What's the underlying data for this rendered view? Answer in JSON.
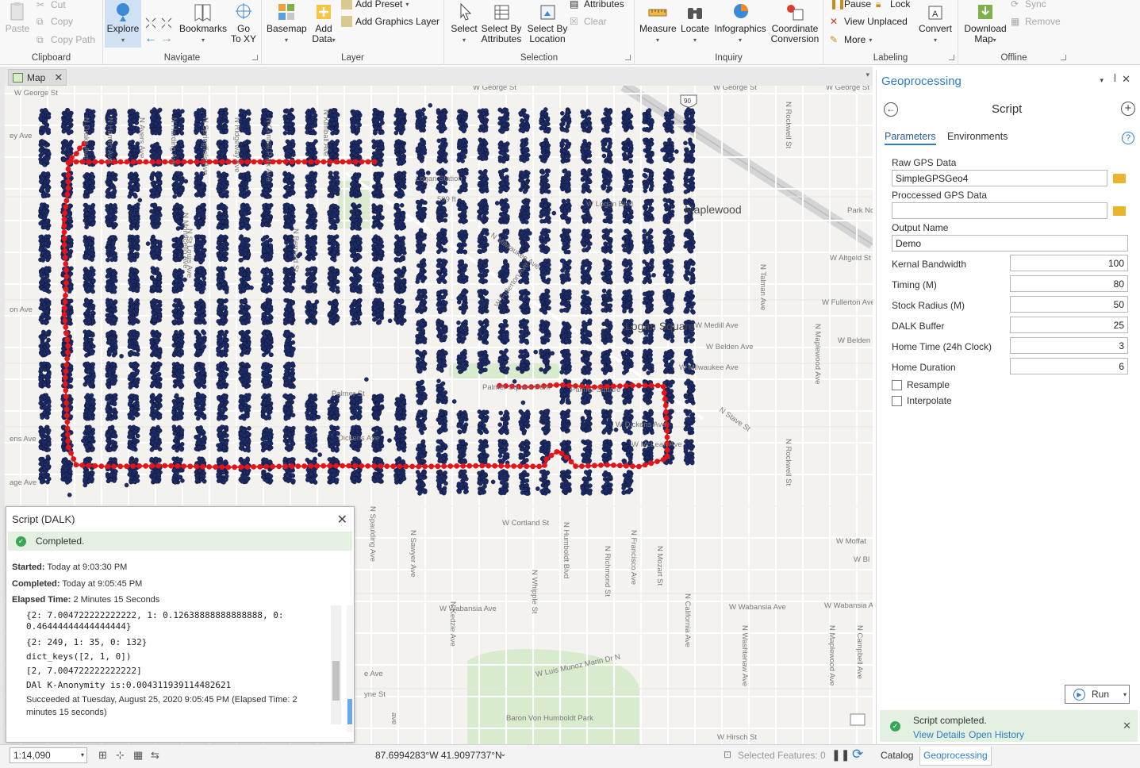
{
  "ribbon": {
    "clipboard": {
      "label": "Clipboard",
      "paste": "Paste",
      "cut": "Cut",
      "copy": "Copy",
      "copy_path": "Copy Path"
    },
    "navigate": {
      "label": "Navigate",
      "explore": "Explore",
      "bookmarks": "Bookmarks",
      "go_to_xy": "Go\nTo XY"
    },
    "layer": {
      "label": "Layer",
      "basemap": "Basemap",
      "add_data": "Add\nData",
      "add_preset": "Add Preset",
      "add_graphics_layer": "Add Graphics Layer"
    },
    "selection": {
      "label": "Selection",
      "select": "Select",
      "select_by_attributes": "Select By\nAttributes",
      "select_by_location": "Select By\nLocation",
      "attributes": "Attributes",
      "clear": "Clear"
    },
    "inquiry": {
      "label": "Inquiry",
      "measure": "Measure",
      "locate": "Locate",
      "infographics": "Infographics",
      "coordinate_conversion": "Coordinate\nConversion"
    },
    "labeling": {
      "label": "Labeling",
      "pause": "Pause",
      "lock": "Lock",
      "view_unplaced": "View Unplaced",
      "more": "More",
      "convert": "Convert"
    },
    "offline": {
      "label": "Offline",
      "download_map": "Download\nMap",
      "sync": "Sync",
      "remove": "Remove"
    }
  },
  "map": {
    "tab_label": "Map",
    "interstate": "90",
    "elevation": "599 ft",
    "places": [
      "Maplewood",
      "Logan Square"
    ],
    "streets": [
      "W George St",
      "W George St",
      "W George St",
      "W George St",
      "W Logan Blvd",
      "W Altgeld St",
      "W Fullerton Ave",
      "W Fullerton Ave",
      "W Medill Ave",
      "W Belden",
      "W Belden Ave",
      "N Milwaukee Ave",
      "W Milwaukee Ave",
      "Logan Station",
      "Park Nc",
      "Palmer Square Park",
      "Palmer Square",
      "Palmer St",
      "Dickens Ave",
      "W Dickens Ave",
      "W McLean Ave",
      "N Stave St",
      "W Cortland St",
      "W Moffat",
      "W Bl",
      "W Wabansia Ave",
      "W Wabansia Ave",
      "W Wabansia Ave",
      "W Luis Munoz Marin Dr N",
      "W Hirsch St",
      "Baron Von Humboldt Park",
      "N Rockwell St",
      "N Rockwell St",
      "N Talman Ave",
      "N Maplewood Ave",
      "N Maplewood Ave",
      "N Campbell Ave",
      "N Washtenaw Ave",
      "N California Ave",
      "N Mozart St",
      "N Francisco Ave",
      "N Richmond St",
      "N Humboldt Blvd",
      "N Whipple St",
      "N Kedzie Ave",
      "N Sawyer Ave",
      "N Spaulding Ave",
      "N Kimball Ave",
      "N Bernard St",
      "N Central Park Ave",
      "N Ridgeway Ave",
      "N Springfield Ave",
      "N Harding Ave",
      "N Avers Ave",
      "N Hamlin Ave",
      "ey Ave",
      "on Ave",
      "ens Ave",
      "age Ave",
      "e Ave",
      "yne St",
      "ave",
      "N Drake Ave",
      "N St Louis Ave",
      "N Monticello Ave"
    ]
  },
  "message_popup": {
    "title": "Script (DALK)",
    "status": "Completed.",
    "started_label": "Started:",
    "started_value": "Today at 9:03:30 PM",
    "completed_label": "Completed:",
    "completed_value": "Today at 9:05:45 PM",
    "elapsed_label": "Elapsed Time:",
    "elapsed_value": "2 Minutes 15 Seconds",
    "log": [
      "{2: 7.004722222222222, 1: 0.12638888888888888, 0:",
      "0.46444444444444444}",
      "{2: 249, 1: 35, 0: 132}",
      "dict_keys([2, 1, 0])",
      "[2, 7.004722222222222]",
      "DAl K-Anonymity is:0.004311939114482621"
    ],
    "succeeded": "Succeeded at Tuesday, August 25, 2020 9:05:45 PM (Elapsed Time: 2 minutes 15 seconds)"
  },
  "geoprocessing": {
    "pane_title": "Geoprocessing",
    "tool_title": "Script",
    "tabs": [
      "Parameters",
      "Environments"
    ],
    "raw_gps_label": "Raw GPS Data",
    "raw_gps_value": "SimpleGPSGeo4",
    "processed_gps_label": "Proccessed GPS Data",
    "processed_gps_value": "",
    "output_name_label": "Output Name",
    "output_name_value": "Demo",
    "numeric": [
      {
        "label": "Kernal Bandwidth",
        "value": "100"
      },
      {
        "label": "Timing (M)",
        "value": "80"
      },
      {
        "label": "Stock Radius (M)",
        "value": "50"
      },
      {
        "label": "DALK Buffer",
        "value": "25"
      },
      {
        "label": "Home Time (24h Clock)",
        "value": "3"
      },
      {
        "label": "Home Duration",
        "value": "6"
      }
    ],
    "checkboxes": [
      "Resample",
      "Interpolate"
    ],
    "run_label": "Run",
    "completed_msg": "Script completed.",
    "view_details": "View Details",
    "open_history": "Open History"
  },
  "status_bar": {
    "scale": "1:14,090",
    "coordinates": "87.6994283°W 41.9097737°N",
    "selected_features": "Selected Features: 0"
  },
  "bottom_tabs": [
    "Catalog",
    "Geoprocessing"
  ],
  "colors": {
    "accent": "#2d7cc8",
    "points": "#1d2c66",
    "trajectory": "#e4141b",
    "success": "#3aa655"
  }
}
